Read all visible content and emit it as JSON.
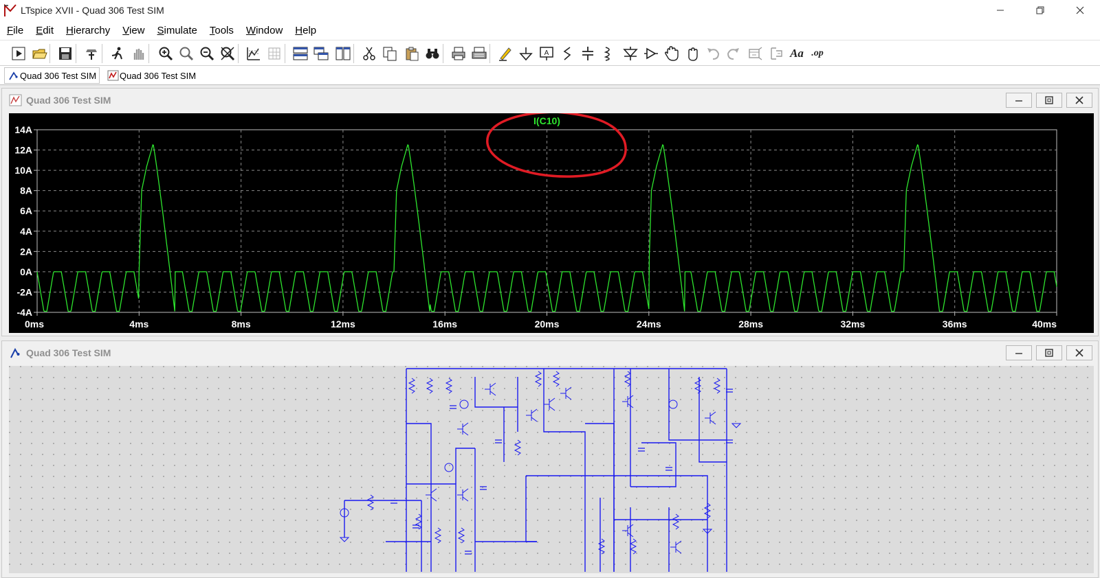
{
  "window": {
    "title": "LTspice XVII - Quad 306 Test SIM",
    "controls": [
      "minimize",
      "restore",
      "close"
    ]
  },
  "menu": {
    "items": [
      {
        "mnemonic": "F",
        "rest": "ile"
      },
      {
        "mnemonic": "E",
        "rest": "dit"
      },
      {
        "mnemonic": "H",
        "rest": "ierarchy"
      },
      {
        "mnemonic": "V",
        "rest": "iew"
      },
      {
        "mnemonic": "S",
        "rest": "imulate"
      },
      {
        "mnemonic": "T",
        "rest": "ools"
      },
      {
        "mnemonic": "W",
        "rest": "indow"
      },
      {
        "mnemonic": "H",
        "rest": "elp"
      }
    ]
  },
  "toolbar": {
    "icons": [
      "run-icon",
      "open-icon",
      "save-icon",
      "control-panel-icon",
      "run-sim-icon",
      "pan-icon",
      "zoom-in-icon",
      "zoom-area-icon",
      "zoom-out-icon",
      "zoom-cancel-icon",
      "autorange-icon",
      "grid-icon",
      "tile-horizontal-icon",
      "cascade-icon",
      "tile-vertical-icon",
      "cut-icon",
      "copy-icon",
      "paste-icon",
      "find-icon",
      "print-icon",
      "print-setup-icon",
      "draw-wire-icon",
      "ground-icon",
      "label-net-icon",
      "resistor-icon",
      "capacitor-icon",
      "inductor-icon",
      "diode-icon",
      "component-icon",
      "move-icon",
      "drag-icon",
      "undo-icon",
      "redo-icon",
      "rotate-icon",
      "mirror-icon",
      "text-icon",
      "spice-directive-icon"
    ],
    "text_icon_label": "Aa",
    "op_label": ".op"
  },
  "tabs": [
    {
      "label": "Quad 306 Test SIM",
      "active": true
    },
    {
      "label": "Quad 306 Test SIM",
      "active": false
    }
  ],
  "waveform_window": {
    "title": "Quad 306 Test SIM"
  },
  "schematic_window": {
    "title": "Quad 306 Test SIM"
  },
  "chart_data": {
    "type": "line",
    "title": "",
    "trace_label": "I(C10)",
    "trace_color": "#2ee62e",
    "background": "#000000",
    "grid": true,
    "xlim": [
      0,
      40
    ],
    "ylim": [
      -4,
      14
    ],
    "x_ticks": [
      "0ms",
      "4ms",
      "8ms",
      "12ms",
      "16ms",
      "20ms",
      "24ms",
      "28ms",
      "32ms",
      "36ms",
      "40ms"
    ],
    "y_ticks": [
      "14A",
      "12A",
      "10A",
      "8A",
      "6A",
      "4A",
      "2A",
      "0A",
      "-2A",
      "-4A"
    ],
    "x_unit": "ms",
    "y_unit": "A",
    "period_ms": 10,
    "pulse_starts_ms": [
      4.0,
      14.0,
      24.0,
      34.0
    ],
    "pulse_rise_to_ms": 0.1,
    "pulse_knee": [
      0.3,
      10.4
    ],
    "pulse_peak": [
      0.55,
      12.6
    ],
    "pulse_end_ms": 1.4,
    "ripple_period_ms": 0.95,
    "ripple_amplitude_A": 3.9,
    "annotation": "red-hand-drawn-circle-around-trace-label"
  }
}
